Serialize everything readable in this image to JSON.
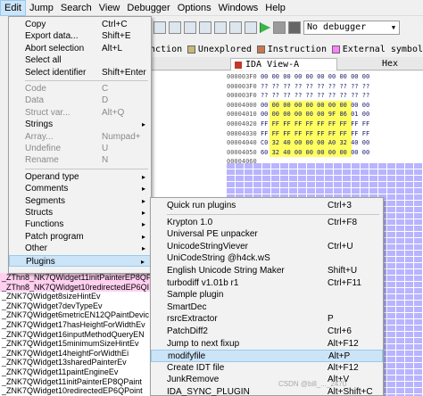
{
  "menubar": [
    {
      "id": "edit",
      "label": "Edit",
      "active": true
    },
    {
      "id": "jump",
      "label": "Jump"
    },
    {
      "id": "search",
      "label": "Search"
    },
    {
      "id": "view",
      "label": "View"
    },
    {
      "id": "debugger",
      "label": "Debugger"
    },
    {
      "id": "options",
      "label": "Options"
    },
    {
      "id": "windows",
      "label": "Windows"
    },
    {
      "id": "help",
      "label": "Help"
    }
  ],
  "toolbar": {
    "debugger_select": "No debugger"
  },
  "legend": {
    "function_text": "nction",
    "unexplored": "Unexplored",
    "instruction": "Instruction",
    "external_symbol": "External symbol",
    "colors": {
      "unexplored": "#c8b878",
      "instruction": "#c87850",
      "external_symbol": "#ff80ff"
    }
  },
  "tabs": {
    "ida_view": "IDA View-A",
    "hex": "Hex"
  },
  "hex_rows": [
    {
      "addr": "000003F0",
      "bytes": "00 00 00 00 00 00 00 00 00 00"
    },
    {
      "addr": "000003F0",
      "bytes": "?? ?? ?? ?? ?? ?? ?? ?? ?? ??"
    },
    {
      "addr": "000003F0",
      "bytes": "?? ?? ?? ?? ?? ?? ?? ?? ?? ??"
    },
    {
      "addr": "00004000",
      "bytes": "00 00 00 00 00 00 00 00 00 00"
    },
    {
      "addr": "00004010",
      "bytes": "00 00 00 00 00 00 9F 86 01 00"
    },
    {
      "addr": "00004020",
      "bytes": "FF FF FF FF FF FF FF FF FF FF"
    },
    {
      "addr": "00004030",
      "bytes": "FF FF FF FF FF FF FF FF FF FF"
    },
    {
      "addr": "00004040",
      "bytes": "C0 32 40 00 00 00 A0 32 40 00"
    },
    {
      "addr": "00004050",
      "bytes": "60 32 40 00 00 00 00 00 00 00"
    },
    {
      "addr": "00004060",
      "bytes": ""
    }
  ],
  "edit_menu": {
    "items": [
      {
        "label": "Copy",
        "shortcut": "Ctrl+C"
      },
      {
        "label": "Export data...",
        "shortcut": "Shift+E"
      },
      {
        "label": "Abort selection",
        "shortcut": "Alt+L"
      },
      {
        "label": "Select all",
        "shortcut": ""
      },
      {
        "label": "Select identifier",
        "shortcut": "Shift+Enter"
      },
      {
        "label": "Code",
        "shortcut": "C",
        "disabled": true
      },
      {
        "label": "Data",
        "shortcut": "D",
        "disabled": true
      },
      {
        "label": "Struct var...",
        "shortcut": "Alt+Q",
        "disabled": true
      },
      {
        "label": "Strings",
        "shortcut": "",
        "submenu": true
      },
      {
        "label": "Array...",
        "shortcut": "Numpad+",
        "disabled": true
      },
      {
        "label": "Undefine",
        "shortcut": "U",
        "disabled": true
      },
      {
        "label": "Rename",
        "shortcut": "N",
        "disabled": true
      },
      {
        "label": "Operand type",
        "shortcut": "",
        "submenu": true
      },
      {
        "label": "Comments",
        "shortcut": "",
        "submenu": true
      },
      {
        "label": "Segments",
        "shortcut": "",
        "submenu": true
      },
      {
        "label": "Structs",
        "shortcut": "",
        "submenu": true
      },
      {
        "label": "Functions",
        "shortcut": "",
        "submenu": true
      },
      {
        "label": "Patch program",
        "shortcut": "",
        "submenu": true
      },
      {
        "label": "Other",
        "shortcut": "",
        "submenu": true
      },
      {
        "label": "Plugins",
        "shortcut": "",
        "submenu": true,
        "highlighted": true
      }
    ]
  },
  "plugins_menu": {
    "items": [
      {
        "label": "Quick run plugins",
        "shortcut": "Ctrl+3"
      },
      {
        "label": "Krypton 1.0",
        "shortcut": "Ctrl+F8"
      },
      {
        "label": "Universal PE unpacker",
        "shortcut": ""
      },
      {
        "label": "UnicodeStringViever",
        "shortcut": "Ctrl+U"
      },
      {
        "label": "UniCodeString @h4ck.wS",
        "shortcut": ""
      },
      {
        "label": "English Unicode String Maker",
        "shortcut": "Shift+U"
      },
      {
        "label": "turbodiff v1.01b r1",
        "shortcut": "Ctrl+F11"
      },
      {
        "label": "Sample plugin",
        "shortcut": ""
      },
      {
        "label": "SmartDec",
        "shortcut": ""
      },
      {
        "label": "rsrcExtractor",
        "shortcut": "P"
      },
      {
        "label": "PatchDiff2",
        "shortcut": "Ctrl+6"
      },
      {
        "label": "Jump to next fixup",
        "shortcut": "Alt+F12"
      },
      {
        "label": "modifyfile",
        "shortcut": "Alt+P",
        "highlighted": true
      },
      {
        "label": "Create IDT file",
        "shortcut": "Alt+F12"
      },
      {
        "label": "JunkRemove",
        "shortcut": "Alt+V"
      },
      {
        "label": "IDA_SYNC_PLUGIN",
        "shortcut": "Alt+Shift+C"
      }
    ]
  },
  "function_list": [
    "_ZThn8_NK7QWidget11initPainterEP8QP",
    "_ZThn8_NK7QWidget10redirectedEP6QI",
    "_ZNK7QWidget8sizeHintEv",
    "_ZNK7QWidget7devTypeEv",
    "_ZNK7QWidget6metricEN12QPaintDevic",
    "_ZNK7QWidget17hasHeightForWidthEv",
    "_ZNK7QWidget16inputMethodQueryEN",
    "_ZNK7QWidget15minimumSizeHintEv",
    "_ZNK7QWidget14heightForWidthEi",
    "_ZNK7QWidget13sharedPainterEv",
    "_ZNK7QWidget11paintEngineEv",
    "_ZNK7QWidget11initPainterEP8QPaint",
    "_ZNK7QWidget10redirectedEP6QPoint"
  ],
  "watermark": "CSDN @bill_..._2470"
}
